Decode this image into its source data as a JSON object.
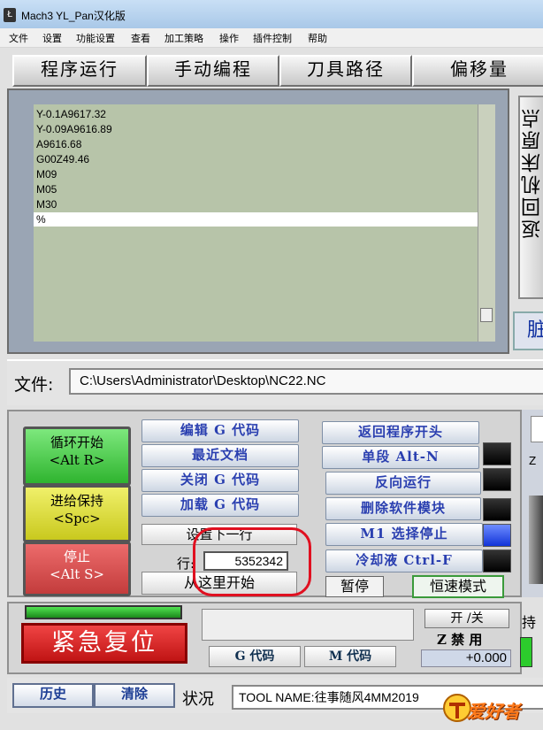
{
  "window": {
    "title": "Mach3 YL_Pan汉化版",
    "icon": "mach3-app-icon"
  },
  "menu": [
    "文件",
    "设置",
    "功能设置",
    "查看",
    "加工策略",
    "操作",
    "插件控制",
    "帮助"
  ],
  "tabs": [
    "程序运行",
    "手动编程",
    "刀具路径",
    "偏移量"
  ],
  "code_lines": [
    "Y-0.1A9617.32",
    "Y-0.09A9616.89",
    "A9616.68",
    "G00Z49.46",
    "M09",
    "M05",
    "M30",
    "%"
  ],
  "side_buttons": {
    "top": "返回机床原点",
    "bottom": "脏"
  },
  "file": {
    "label": "文件:",
    "path": "C:\\Users\\Administrator\\Desktop\\NC22.NC"
  },
  "controls": {
    "cycle_start": {
      "line1": "循环开始",
      "line2": "<Alt R>"
    },
    "feed_hold": {
      "line1": "进给保持",
      "line2": "<Spc>"
    },
    "stop": {
      "line1": "停止",
      "line2": "<Alt S>"
    },
    "edit_gcode": "编辑 G 代码",
    "recent_files": "最近文档",
    "close_gcode": "关闭 G 代码",
    "load_gcode": "加载 G 代码",
    "set_next_line": "设置下一行",
    "line_label": "行:",
    "line_value": "5352342",
    "run_from_here": "从这里开始",
    "rewind": "返回程序开头",
    "single_block": "单段 Alt-N",
    "reverse_run": "反向运行",
    "block_delete": "删除软件模块",
    "m1_optional_stop": "M1 选择停止",
    "coolant": "冷却液 Ctrl-F",
    "pause": "暂停",
    "const_speed": "恒速模式"
  },
  "bottom": {
    "emergency_reset": "紧急复位",
    "gcode_btn": "G 代码",
    "mcode_btn": "M 代码",
    "on_off": "开 /关",
    "z_inhibit": "Z 禁 用",
    "z_value": "+0.000",
    "right_hold": "持",
    "right_z": "Z"
  },
  "status": {
    "history_btn": "历史",
    "clear_btn": "清除",
    "label": "状况",
    "text": "TOOL NAME:往事随风4MM2019"
  },
  "watermark": "爱好者",
  "colors": {
    "code_bg": "#b7c4a9",
    "emergency": "#d42020",
    "cycle_start": "#3cc63c",
    "feed_hold": "#e3e33c",
    "stop": "#d85050",
    "led_active": "#2244e8"
  }
}
